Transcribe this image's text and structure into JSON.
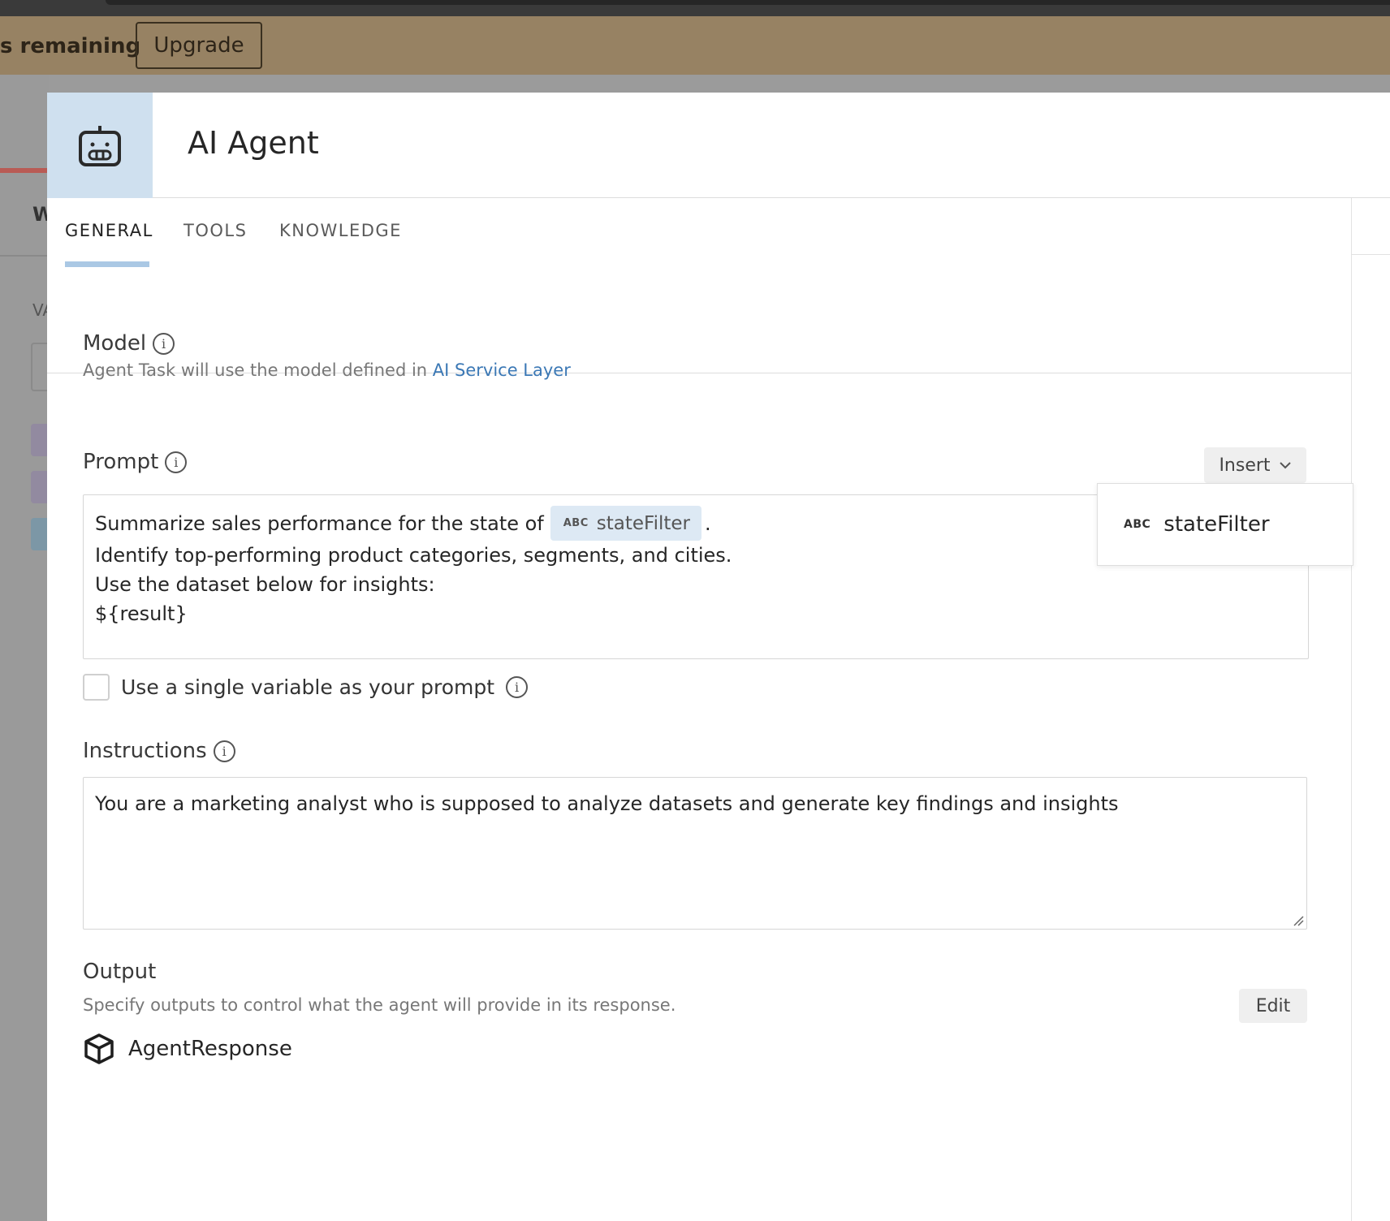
{
  "banner": {
    "remaining_text": "s remaining",
    "upgrade_label": "Upgrade"
  },
  "background_app": {
    "letter_w": "W",
    "letter_va": "VA"
  },
  "dialog": {
    "title": "AI Agent",
    "icon": "robot-icon",
    "tabs": [
      {
        "label": "GENERAL",
        "active": true
      },
      {
        "label": "TOOLS",
        "active": false
      },
      {
        "label": "KNOWLEDGE",
        "active": false
      }
    ]
  },
  "model": {
    "label": "Model",
    "description_prefix": "Agent Task will use the model defined in ",
    "link_text": "AI Service Layer"
  },
  "prompt": {
    "label": "Prompt",
    "insert_label": "Insert",
    "line1_prefix": "Summarize sales performance for the state of",
    "variable_type": "ABC",
    "variable_name": "stateFilter",
    "line1_suffix": ".",
    "line2": "Identify top-performing product categories, segments, and cities.",
    "line3": "Use the dataset below for insights:",
    "line4": "${result}"
  },
  "insert_dropdown": {
    "items": [
      {
        "type": "ABC",
        "name": "stateFilter"
      }
    ]
  },
  "single_variable": {
    "label": "Use a single variable as your prompt",
    "checked": false
  },
  "instructions": {
    "label": "Instructions",
    "value": "You are a marketing analyst who is supposed to analyze datasets and generate key findings and insights"
  },
  "output": {
    "label": "Output",
    "description": "Specify outputs to control what the agent will provide in its response.",
    "edit_label": "Edit",
    "item_name": "AgentResponse",
    "item_icon": "cube-icon"
  },
  "colors": {
    "banner": "#978263",
    "icon_bg": "#cfe0ef",
    "tab_underline": "#aac8e4",
    "link": "#3b78b5",
    "chip": "#dde9f4"
  }
}
